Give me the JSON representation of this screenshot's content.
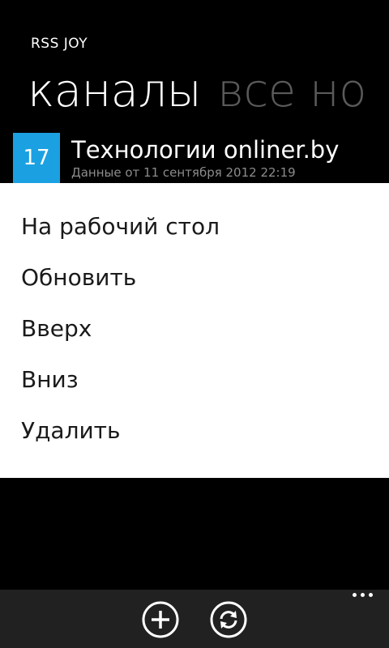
{
  "app": {
    "title": "RSS JOY"
  },
  "pivot": {
    "items": [
      {
        "label": "каналы",
        "active": true
      },
      {
        "label": "все но",
        "active": false
      }
    ]
  },
  "feed": {
    "count": "17",
    "name": "Технологии onliner.by",
    "subtitle": "Данные от 11 сентября 2012 22:19",
    "tile_color": "#1ba1e2"
  },
  "context_menu": {
    "items": [
      {
        "label": "На рабочий стол"
      },
      {
        "label": "Обновить"
      },
      {
        "label": "Вверх"
      },
      {
        "label": "Вниз"
      },
      {
        "label": "Удалить"
      }
    ]
  },
  "app_bar": {
    "buttons": [
      {
        "icon": "add-icon"
      },
      {
        "icon": "refresh-icon"
      }
    ],
    "more_icon": "ellipsis-icon"
  }
}
